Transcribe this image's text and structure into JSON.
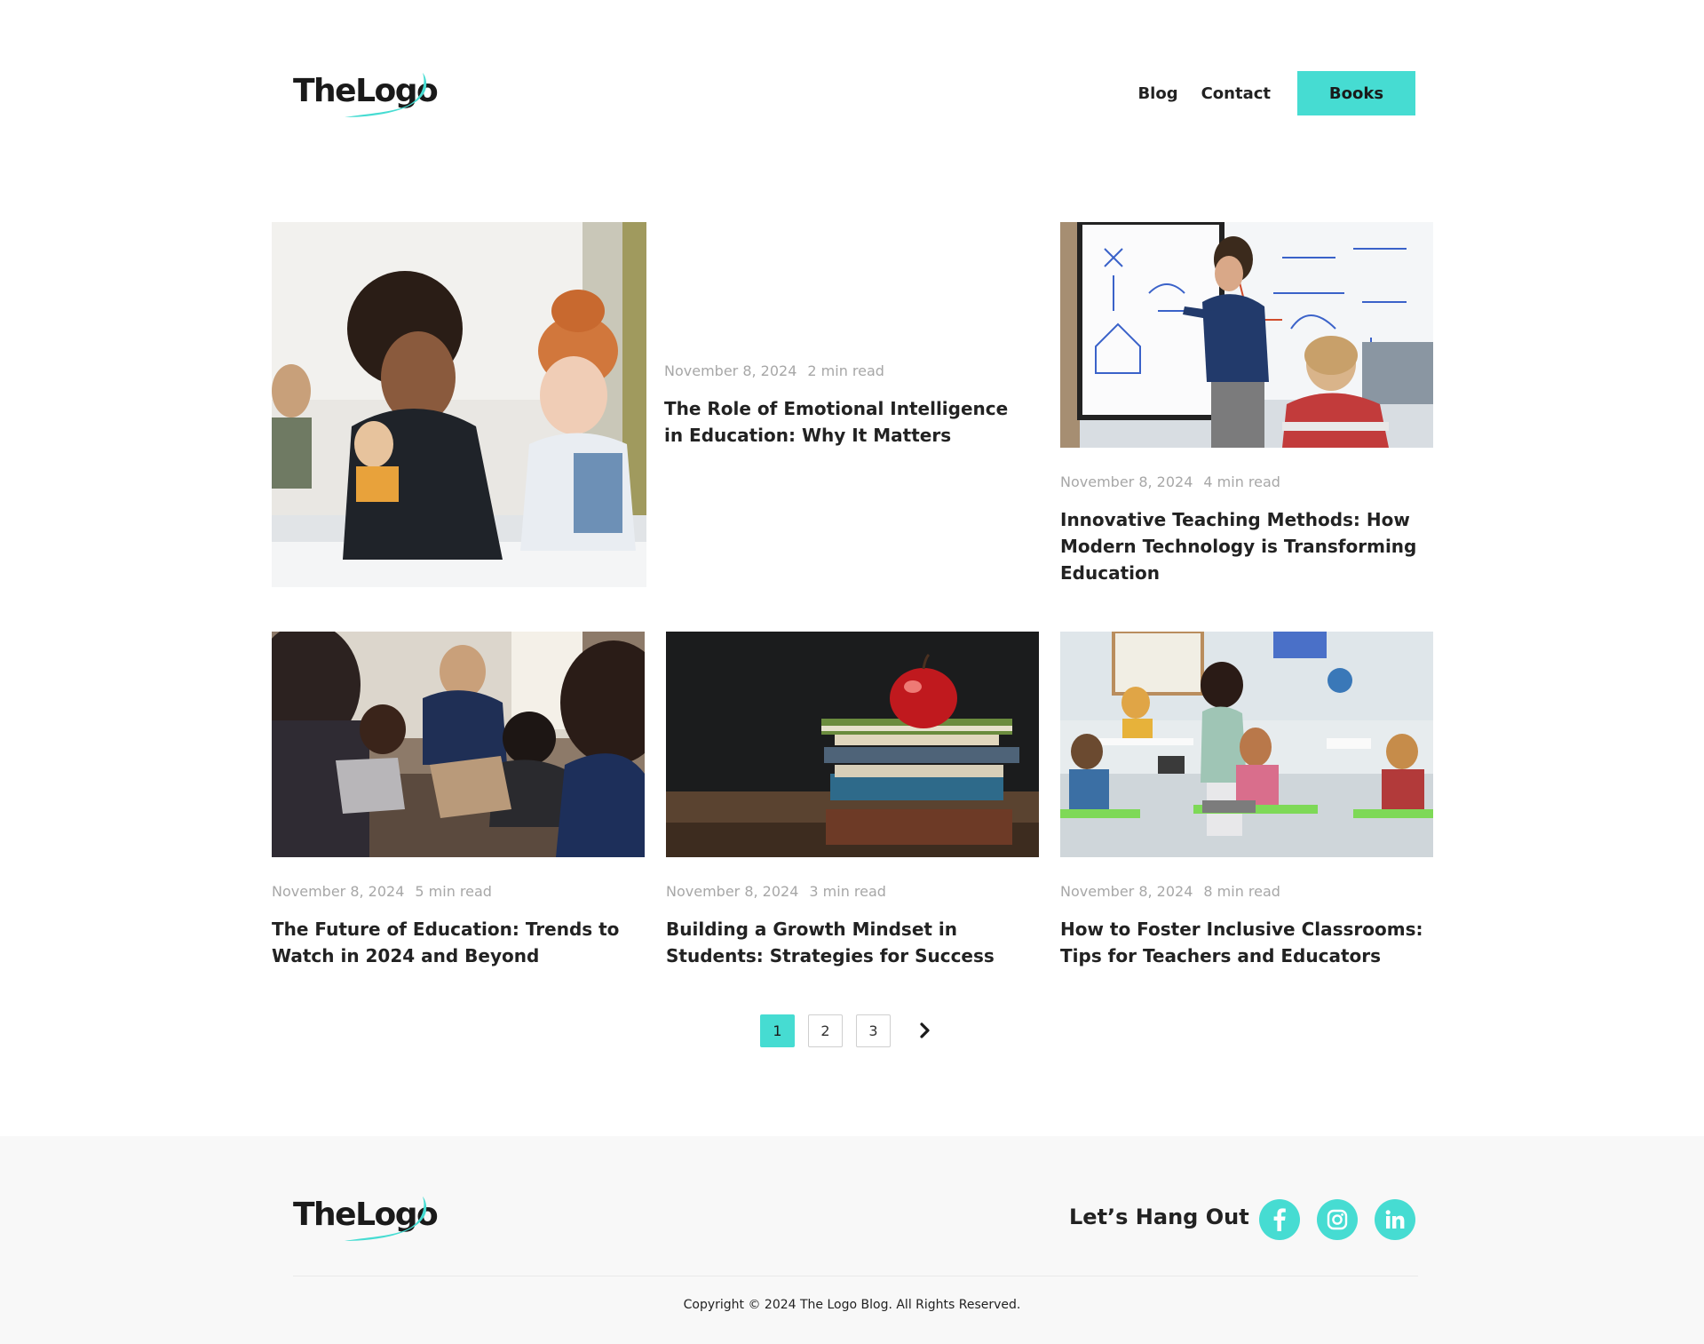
{
  "brand": {
    "logo_text": "TheLogo",
    "accent_color": "#46dcd2"
  },
  "nav": {
    "items": [
      "Blog",
      "Contact"
    ],
    "cta_label": "Books"
  },
  "posts": [
    {
      "date": "November 8, 2024",
      "read_time": "2 min read",
      "title": "The Role of Emotional Intelligence in Education: Why It Matters",
      "image": "teacher-helping-student-writing"
    },
    {
      "date": "November 8, 2024",
      "read_time": "4 min read",
      "title": "Innovative Teaching Methods: How Modern Technology is Transforming Education",
      "image": "teacher-at-whiteboard-diagram"
    },
    {
      "date": "November 8, 2024",
      "read_time": "5 min read",
      "title": "The Future of Education: Trends to Watch in 2024 and Beyond",
      "image": "students-with-laptops-and-teacher"
    },
    {
      "date": "November 8, 2024",
      "read_time": "3 min read",
      "title": "Building a Growth Mindset in Students: Strategies for Success",
      "image": "apple-on-stack-of-books"
    },
    {
      "date": "November 8, 2024",
      "read_time": "8 min read",
      "title": "How to Foster Inclusive Classrooms: Tips for Teachers and Educators",
      "image": "classroom-with-tablets"
    }
  ],
  "pagination": {
    "pages": [
      "1",
      "2",
      "3"
    ],
    "current": "1",
    "next_icon": "chevron-right-icon"
  },
  "footer": {
    "tagline": "Let’s Hang Out",
    "socials": [
      "facebook-icon",
      "instagram-icon",
      "linkedin-icon"
    ],
    "copyright": "Copyright © 2024 The Logo Blog. All Rights Reserved."
  }
}
